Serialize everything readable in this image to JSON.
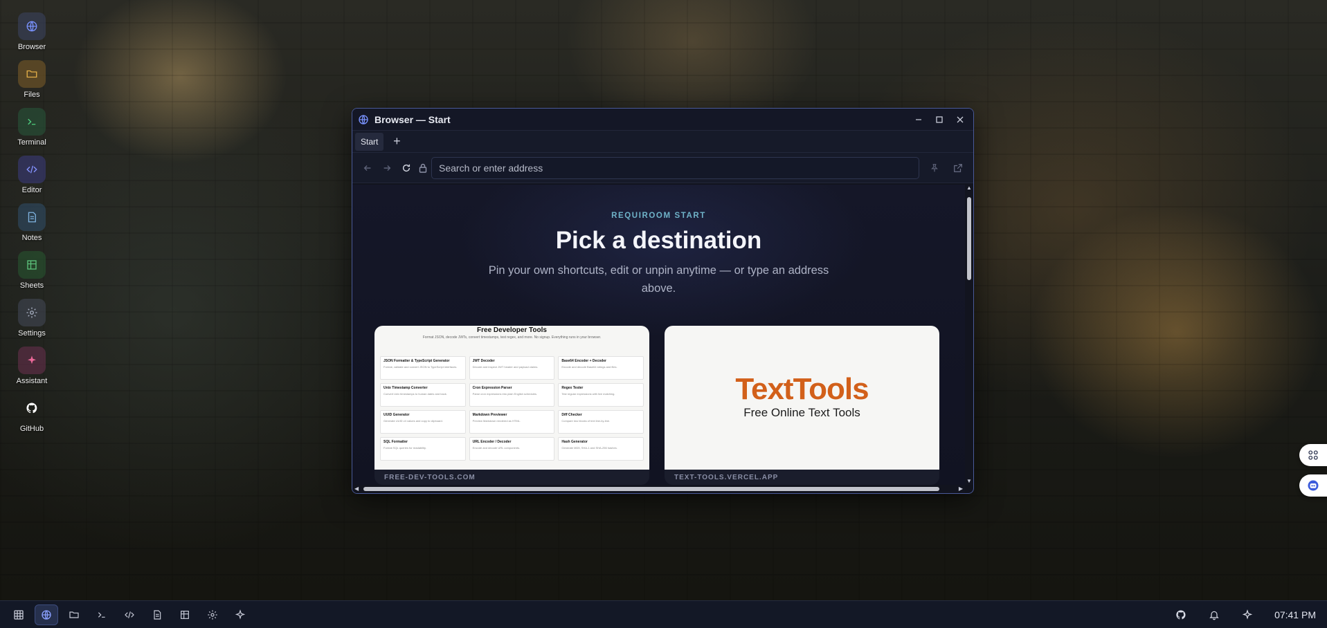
{
  "desktop": {
    "icons": [
      {
        "label": "Browser",
        "icon": "globe-icon",
        "color": "#5b7cff"
      },
      {
        "label": "Files",
        "icon": "folder-icon",
        "color": "#d9a23a"
      },
      {
        "label": "Terminal",
        "icon": "terminal-icon",
        "color": "#3fbf6f"
      },
      {
        "label": "Editor",
        "icon": "code-icon",
        "color": "#6f7dff"
      },
      {
        "label": "Notes",
        "icon": "document-icon",
        "color": "#6fa8dc"
      },
      {
        "label": "Sheets",
        "icon": "table-icon",
        "color": "#4caf6a"
      },
      {
        "label": "Settings",
        "icon": "gear-icon",
        "color": "#9aa3b5"
      },
      {
        "label": "Assistant",
        "icon": "sparkle-icon",
        "color": "#e35d8f"
      },
      {
        "label": "GitHub",
        "icon": "github-icon",
        "color": "#ffffff"
      }
    ]
  },
  "window": {
    "title": "Browser — Start",
    "tabs": [
      {
        "label": "Start"
      }
    ],
    "new_tab_label": "+",
    "address": {
      "value": "",
      "placeholder": "Search or enter address"
    }
  },
  "page": {
    "eyebrow": "REQUIROOM START",
    "headline": "Pick a destination",
    "subtitle": "Pin your own shortcuts, edit or unpin anytime — or type an address above.",
    "cards": [
      {
        "caption": "FREE-DEV-TOOLS.COM",
        "thumb_title": "Free Developer Tools",
        "thumb_subtitle": "Format JSON, decode JWTs, convert timestamps, test regex, and more. No signup. Everything runs in your browser.",
        "tools": [
          {
            "name": "JSON Formatter & TypeScript Generator",
            "desc": "Format, validate and convert JSON to TypeScript interfaces."
          },
          {
            "name": "JWT Decoder",
            "desc": "Decode and inspect JWT header and payload claims."
          },
          {
            "name": "Base64 Encoder + Decoder",
            "desc": "Encode and decode Base64 strings and files."
          },
          {
            "name": "Unix Timestamp Converter",
            "desc": "Convert Unix timestamps to human dates and back."
          },
          {
            "name": "Cron Expression Parser",
            "desc": "Parse cron expressions into plain English schedules."
          },
          {
            "name": "Regex Tester",
            "desc": "Test regular expressions with live matching."
          },
          {
            "name": "UUID Generator",
            "desc": "Generate UUID v4 values and copy to clipboard."
          },
          {
            "name": "Markdown Previewer",
            "desc": "Preview Markdown rendered as HTML."
          },
          {
            "name": "Diff Checker",
            "desc": "Compare two blocks of text line-by-line."
          },
          {
            "name": "SQL Formatter",
            "desc": "Format SQL queries for readability."
          },
          {
            "name": "URL Encoder / Decoder",
            "desc": "Encode and decode URL components."
          },
          {
            "name": "Hash Generator",
            "desc": "Generate MD5, SHA-1 and SHA-256 hashes."
          }
        ]
      },
      {
        "caption": "TEXT-TOOLS.VERCEL.APP",
        "logo_text": "TextTools",
        "tagline": "Free Online Text Tools"
      }
    ]
  },
  "taskbar": {
    "items": [
      {
        "name": "apps-grid-icon",
        "active": false
      },
      {
        "name": "globe-icon",
        "active": true
      },
      {
        "name": "folder-icon",
        "active": false
      },
      {
        "name": "terminal-icon",
        "active": false
      },
      {
        "name": "code-icon",
        "active": false
      },
      {
        "name": "document-icon",
        "active": false
      },
      {
        "name": "table-icon",
        "active": false
      },
      {
        "name": "gear-icon",
        "active": false
      },
      {
        "name": "sparkle-icon",
        "active": false
      }
    ],
    "clock": "07:41 PM"
  },
  "colors": {
    "accent": "#5b7cff",
    "eyebrow": "#6fb3c9",
    "texttools_logo": "#d2601a"
  }
}
